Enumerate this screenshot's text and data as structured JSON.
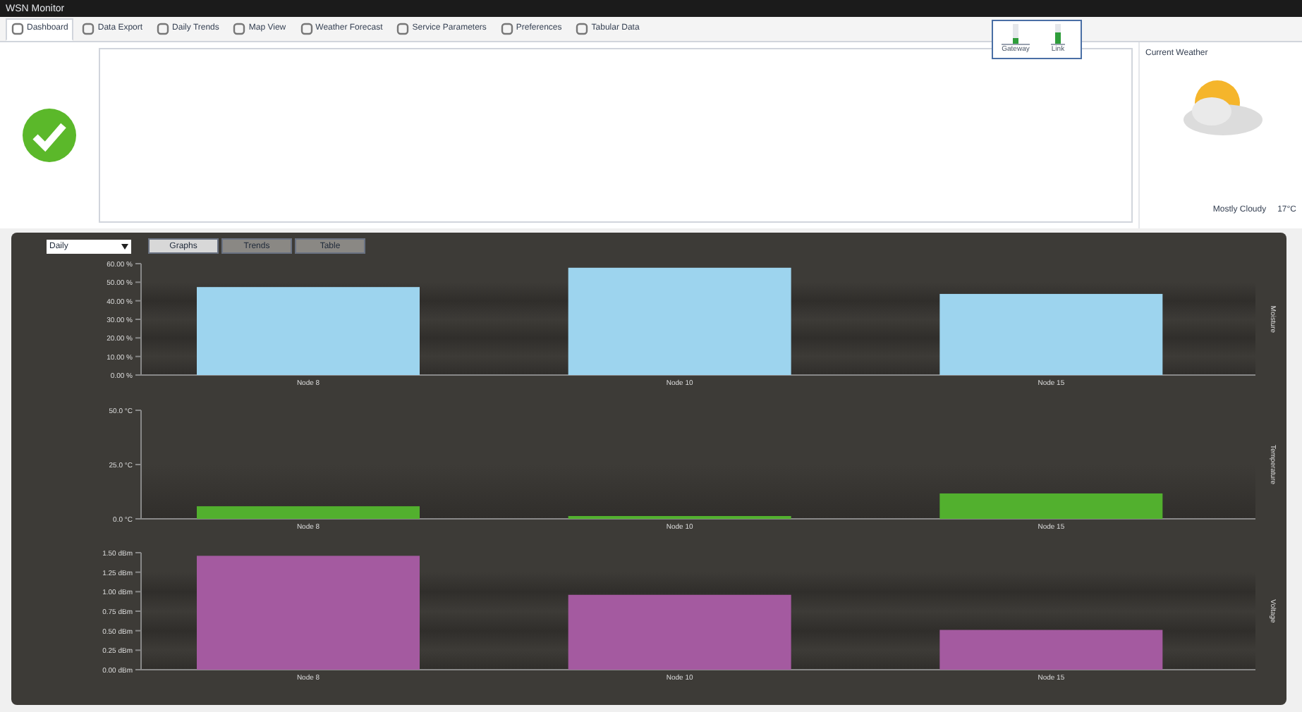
{
  "window": {
    "title": "WSN Monitor"
  },
  "tabs": [
    {
      "label": "Dashboard",
      "selected": true
    },
    {
      "label": "Data Export",
      "selected": false
    },
    {
      "label": "Daily Trends",
      "selected": false
    },
    {
      "label": "Map View",
      "selected": false
    },
    {
      "label": "Weather Forecast",
      "selected": false
    },
    {
      "label": "Service Parameters",
      "selected": false
    },
    {
      "label": "Preferences",
      "selected": false
    },
    {
      "label": "Tabular Data",
      "selected": false
    }
  ],
  "signal_popup": {
    "items": [
      {
        "label": "Gateway",
        "level": 0.3
      },
      {
        "label": "Link",
        "level": 0.6
      }
    ]
  },
  "weather": {
    "title": "Current Weather",
    "condition": "Mostly Cloudy",
    "temperature": "17°C"
  },
  "controls": {
    "period": "Daily",
    "buttons": [
      {
        "label": "Graphs",
        "selected": true
      },
      {
        "label": "Trends",
        "selected": false
      },
      {
        "label": "Table",
        "selected": false
      }
    ]
  },
  "charts": [
    {
      "chart_data": {
        "type": "bar",
        "categories": [
          "Node 8",
          "Node 10",
          "Node 15"
        ],
        "series": [
          {
            "name": "Moisture",
            "color": "#9dd4ee",
            "values": [
              47.4,
              57.8,
              43.7
            ]
          }
        ],
        "ylim": [
          0,
          60
        ],
        "yticks": [
          {
            "value": 0,
            "label": "0.00 %"
          },
          {
            "value": 10,
            "label": "10.00 %"
          },
          {
            "value": 20,
            "label": "20.00 %"
          },
          {
            "value": 30,
            "label": "30.00 %"
          },
          {
            "value": 40,
            "label": "40.00 %"
          },
          {
            "value": 50,
            "label": "50.00 %"
          },
          {
            "value": 60,
            "label": "60.00 %"
          }
        ]
      }
    },
    {
      "chart_data": {
        "type": "bar",
        "categories": [
          "Node 8",
          "Node 10",
          "Node 15"
        ],
        "series": [
          {
            "name": "Temperature",
            "color": "#52b02e",
            "values": [
              5.8,
              1.3,
              11.7
            ]
          }
        ],
        "ylim": [
          0,
          50
        ],
        "yticks": [
          {
            "value": 0,
            "label": "0.0 °C"
          },
          {
            "value": 25,
            "label": "25.0 °C"
          },
          {
            "value": 50,
            "label": "50.0 °C"
          }
        ]
      }
    },
    {
      "chart_data": {
        "type": "bar",
        "categories": [
          "Node 8",
          "Node 10",
          "Node 15"
        ],
        "series": [
          {
            "name": "Voltage",
            "color": "#a45aa0",
            "values": [
              1.46,
              0.96,
              0.51
            ]
          }
        ],
        "ylim": [
          0,
          1.5
        ],
        "yticks": [
          {
            "value": 0,
            "label": "0.00 dBm"
          },
          {
            "value": 0.25,
            "label": "0.25 dBm"
          },
          {
            "value": 0.5,
            "label": "0.50 dBm"
          },
          {
            "value": 0.75,
            "label": "0.75 dBm"
          },
          {
            "value": 1,
            "label": "1.00 dBm"
          },
          {
            "value": 1.25,
            "label": "1.25 dBm"
          },
          {
            "value": 1.5,
            "label": "1.50 dBm"
          }
        ]
      }
    }
  ]
}
